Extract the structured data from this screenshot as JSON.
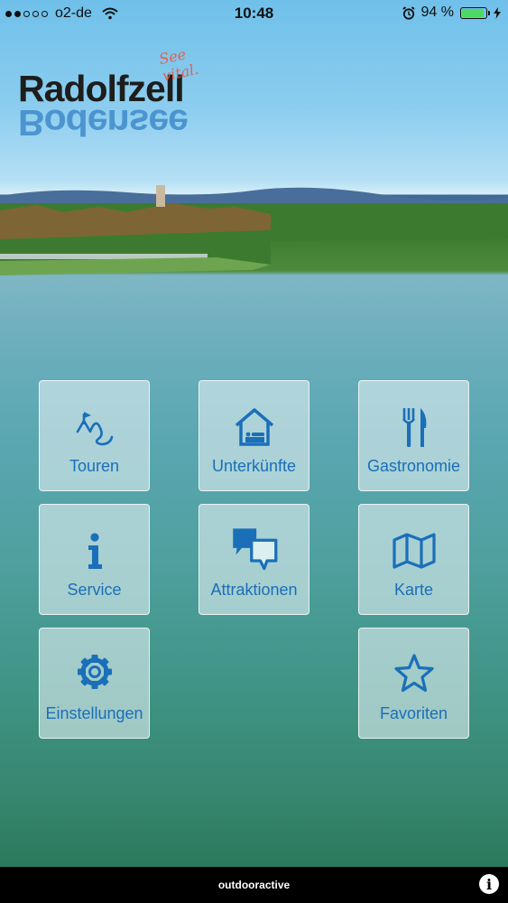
{
  "status_bar": {
    "carrier": "o2-de",
    "time": "10:48",
    "battery": "94 %",
    "battery_level": 0.94,
    "icons": [
      "signal-dots-icon",
      "wifi-icon",
      "alarm-icon",
      "battery-icon",
      "charging-bolt-icon"
    ]
  },
  "logo": {
    "text": "Radolfzell",
    "mirror_text": "Bodensee",
    "tagline": "See vital."
  },
  "menu": {
    "tiles": [
      {
        "label": "Touren",
        "icon": "route-icon"
      },
      {
        "label": "Unterkünfte",
        "icon": "house-bed-icon"
      },
      {
        "label": "Gastronomie",
        "icon": "fork-knife-icon"
      },
      {
        "label": "Service",
        "icon": "info-icon"
      },
      {
        "label": "Attraktionen",
        "icon": "speech-bubbles-icon"
      },
      {
        "label": "Karte",
        "icon": "map-icon"
      },
      {
        "label": "Einstellungen",
        "icon": "gear-icon"
      },
      {
        "label": "Favoriten",
        "icon": "star-icon"
      }
    ]
  },
  "bottom_bar": {
    "brand": "outdooractive",
    "info_icon": "info-circle-icon"
  },
  "colors": {
    "accent": "#1a6fb8",
    "battery_fill": "#4cd964",
    "tagline": "#e4614f"
  }
}
